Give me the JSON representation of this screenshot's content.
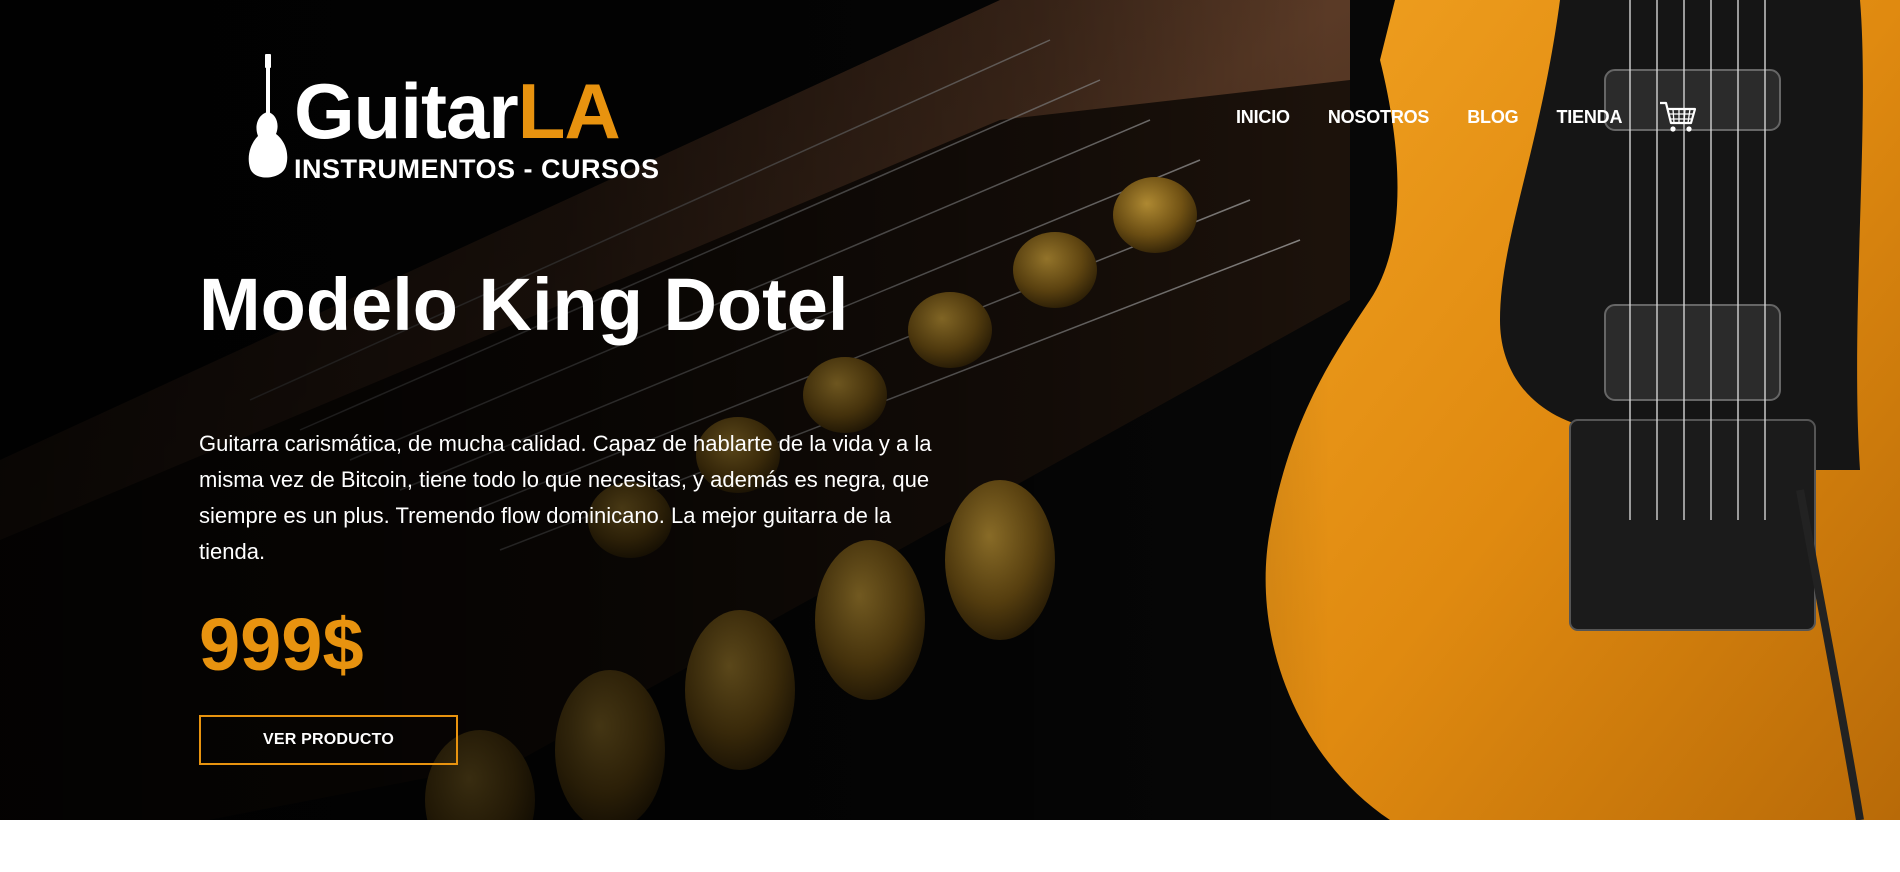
{
  "brand": {
    "name_part1": "Guitar",
    "name_part2": "LA",
    "tagline": "INSTRUMENTOS - CURSOS"
  },
  "nav": {
    "items": [
      "INICIO",
      "NOSOTROS",
      "BLOG",
      "TIENDA"
    ]
  },
  "hero": {
    "title": "Modelo King Dotel",
    "description": "Guitarra carismática, de mucha calidad. Capaz de hablarte de la vida y a la misma vez de Bitcoin, tiene todo lo que necesitas, y además es negra, que siempre es un plus. Tremendo flow dominicano. La mejor guitarra de la tienda.",
    "price": "999$",
    "cta": "VER PRODUCTO"
  },
  "icons": {
    "cart": "shopping-cart-icon",
    "logo": "electric-guitar-icon"
  },
  "colors": {
    "accent": "#e8930f",
    "background": "#050505",
    "text": "#ffffff"
  }
}
